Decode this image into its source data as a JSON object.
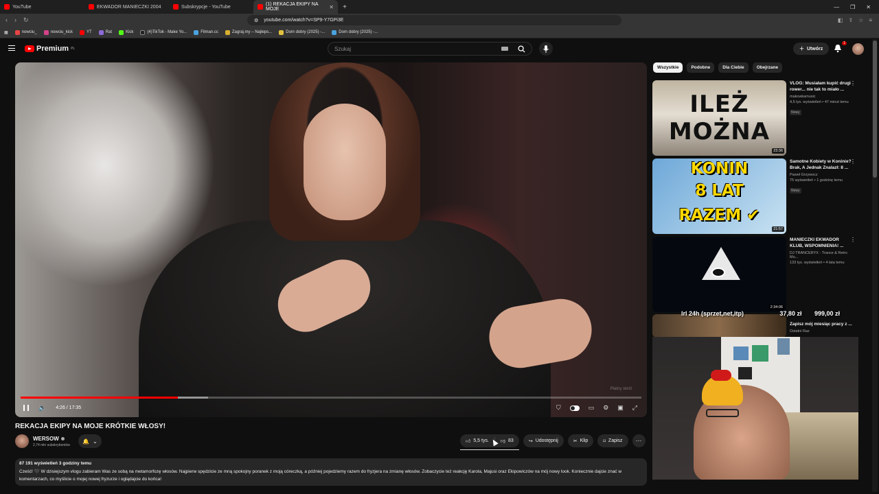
{
  "browser": {
    "tabs": [
      {
        "label": "YouTube",
        "active": false
      },
      {
        "label": "EKWADOR MANIECZKI 2004",
        "active": false
      },
      {
        "label": "Subskrypcje - YouTube",
        "active": false
      },
      {
        "label": "(1) REKACJA EKIPY NA MOJE",
        "active": true
      }
    ],
    "url": "youtube.com/watch?v=SP9-Y7GPi3E",
    "bookmarks": [
      "nowciu_",
      "nowciu_kick",
      "YT",
      "Rat",
      "Kick",
      "(4)TikTok - Make Yo...",
      "Filman.cc",
      "Zagraj.my – Najleps...",
      "Dom dobry (2025) -...",
      "Dom dobry (2025) -..."
    ],
    "bookmark_colors": [
      "#e84545",
      "#d6428a",
      "#ff0000",
      "#8e6ad8",
      "#53fc18",
      "#222222",
      "#4aa3df",
      "#d8b030",
      "#e0c040",
      "#4aa3df"
    ]
  },
  "header": {
    "brand": "Premium",
    "brand_sup": "PL",
    "search_placeholder": "Szukaj",
    "create_label": "Utwórz",
    "notifications_count": "1"
  },
  "player": {
    "current_time": "4:26",
    "duration": "17:35",
    "time_display": "4:26 / 17:35",
    "progress_fraction": 0.253,
    "buffered_fraction": 0.302,
    "watermark": "Płatny skrót"
  },
  "video": {
    "title": "REKACJA EKIPY NA MOJE KRÓTKIE WŁOSY!",
    "channel": "WERSOW",
    "subscribers": "2,74 mln subskrybentów",
    "likes": "5,5 tys.",
    "dislikes": "83",
    "share_label": "Udostępnij",
    "clip_label": "Klip",
    "save_label": "Zapisz",
    "views_meta": "87 191 wyświetleń  3 godziny temu",
    "description": "Cześć! 🖤 W dzisiejszym vlogu zabieram Was ze sobą na metamorfozę włosów. Najpierw spędzicie ze mną spokojny poranek z moją córeczką, a później pojedziemy razem do fryzjera na zmianę włosów. Zobaczycie też reakcję Karola, Majusi oraz Ekipowiczów na mój nowy look. Koniecznie dajcie znać w komentarzach, co myślicie o mojej nowej fryzurze i oglądajcie do końca!"
  },
  "filters": [
    "Wszystkie",
    "Podobne",
    "Dla Ciebie",
    "Obejrzane"
  ],
  "recommendations": [
    {
      "title": "VLOG: Musiałam kupić drugi rower... nie tak to miało ...",
      "channel": "makowkamusic",
      "meta": "4,5 tys. wyświetleń • 47 minut temu",
      "badge": "Nowy",
      "duration": "23:36",
      "thumb_text": "ILEŻ MOŻNA"
    },
    {
      "title": "Samotne Kobiety w Koninie? Brak, A Jednak Znalazł: 8 ...",
      "channel": "Paweł Grzywocz",
      "meta": "75 wyświetleń • 1 godzinę temu",
      "badge": "Nowy",
      "duration": "21:57",
      "thumb_l1": "KONIN",
      "thumb_l2": "8 LAT",
      "thumb_l3": "RAZEM ✔"
    },
    {
      "title": "MANIECZKI EKWADOR KLUB, WSPOMNIENIA! ...",
      "channel": "DJ TRANCERYX - Trance & Retro Mu...",
      "meta": "133 tys. wyświetleń • 4 lata temu",
      "badge": "",
      "duration": "2:34:06"
    },
    {
      "title": "Zapisz mój miesiąc pracy z ...",
      "channel": "Ostatni Raz",
      "meta": "",
      "badge": "",
      "duration": ""
    }
  ],
  "stream_overlay": {
    "left_text": "lrl 24h (sprzet,net,itp)",
    "price1": "37,80 zł",
    "price2": "999,00 zł"
  }
}
